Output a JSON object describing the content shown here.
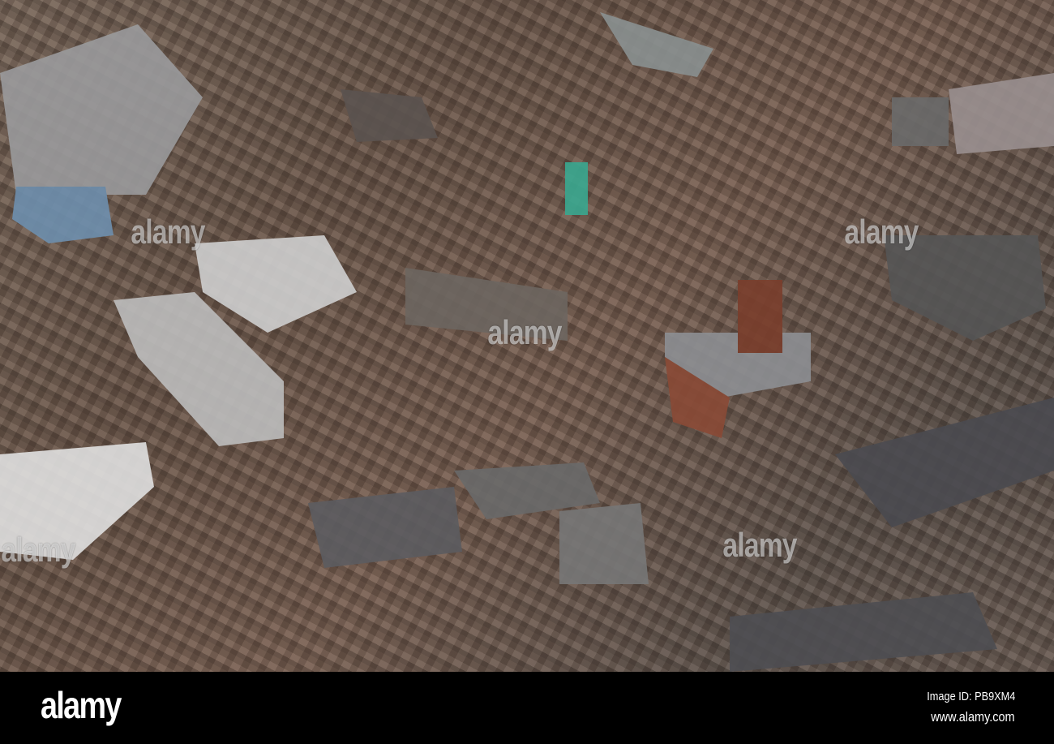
{
  "photo": {
    "subject": "aerial view of town centre rooftops",
    "watermark_text": "alamy",
    "colors": {
      "roof_slate": "#5a5a5e",
      "brick": "#8a4a36",
      "flat_roof": "#c8c8c8",
      "green_glass": "#3aa890"
    }
  },
  "footer": {
    "logo": "alamy",
    "image_id": "Image ID: PB9XM4",
    "website": "www.alamy.com"
  }
}
